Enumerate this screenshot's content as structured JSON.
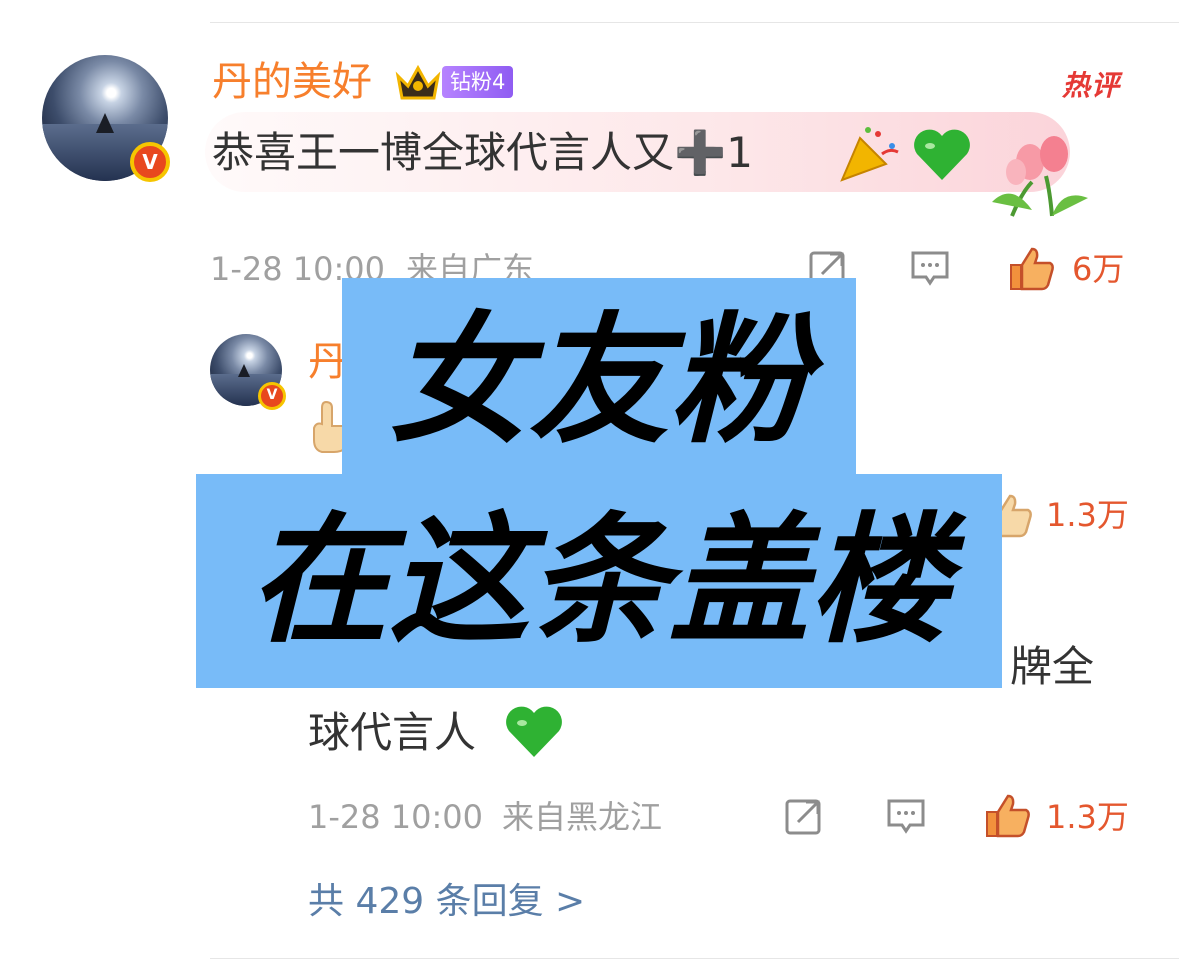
{
  "comment": {
    "username": "丹的美好",
    "fan_badge": "钻粉4",
    "hot_tag": "热评",
    "text": "恭喜王一博全球代言人又➕1",
    "time": "1-28 10:00",
    "location": "来自广东",
    "likes": "6万",
    "icons": [
      "forward-icon",
      "comment-icon",
      "like-icon",
      "crown-icon",
      "party-popper-icon",
      "green-heart-icon",
      "tulip-icon"
    ]
  },
  "reply": {
    "username_partial": "丹",
    "likes_top": "1.3万",
    "text_partial_line1": "牌全",
    "text_line2": "球代言人",
    "time": "1-28 10:00",
    "location": "来自黑龙江",
    "likes": "1.3万",
    "icons": [
      "pointing-hand-icon",
      "green-heart-icon"
    ]
  },
  "footer": {
    "reply_count_text": "共 429 条回复 >"
  },
  "overlay": {
    "line1": "女友粉",
    "line2": "在这条盖楼"
  },
  "colors": {
    "username": "#f77f2c",
    "like": "#e4572e",
    "link": "#5a7ea8",
    "overlay_bg": "#78bbf8",
    "fan_badge": "#a06cf7"
  }
}
